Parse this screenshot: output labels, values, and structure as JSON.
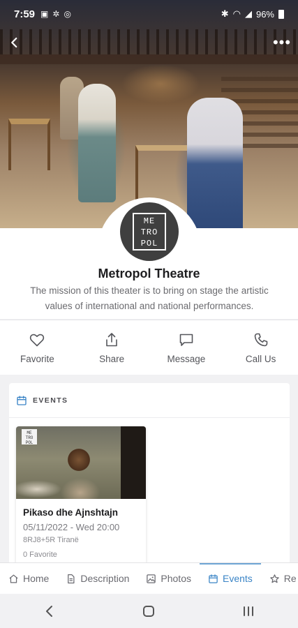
{
  "status_bar": {
    "time": "7:59",
    "battery": "96%"
  },
  "venue": {
    "name": "Metropol Theatre",
    "mission": "The mission of this theater is to bring on stage the artistic values of international and national performances.",
    "logo_text": "ME TRO POL"
  },
  "actions": [
    {
      "label": "Favorite",
      "icon": "heart-icon"
    },
    {
      "label": "Share",
      "icon": "share-icon"
    },
    {
      "label": "Message",
      "icon": "message-icon"
    },
    {
      "label": "Call Us",
      "icon": "phone-icon"
    }
  ],
  "events": {
    "section_title": "EVENTS",
    "items": [
      {
        "title": "Pikaso dhe Ajnshtajn",
        "date": "05/11/2022 - Wed 20:00",
        "location": "8RJ8+5R Tiranë",
        "favorites": "0 Favorite"
      }
    ]
  },
  "tabs": [
    {
      "label": "Home",
      "icon": "home-icon"
    },
    {
      "label": "Description",
      "icon": "description-icon"
    },
    {
      "label": "Photos",
      "icon": "photos-icon"
    },
    {
      "label": "Events",
      "icon": "calendar-icon",
      "active": true
    },
    {
      "label": "Re",
      "icon": "star-icon"
    }
  ],
  "colors": {
    "accent": "#3a84c6",
    "logo_bg": "#3f3f3f"
  }
}
